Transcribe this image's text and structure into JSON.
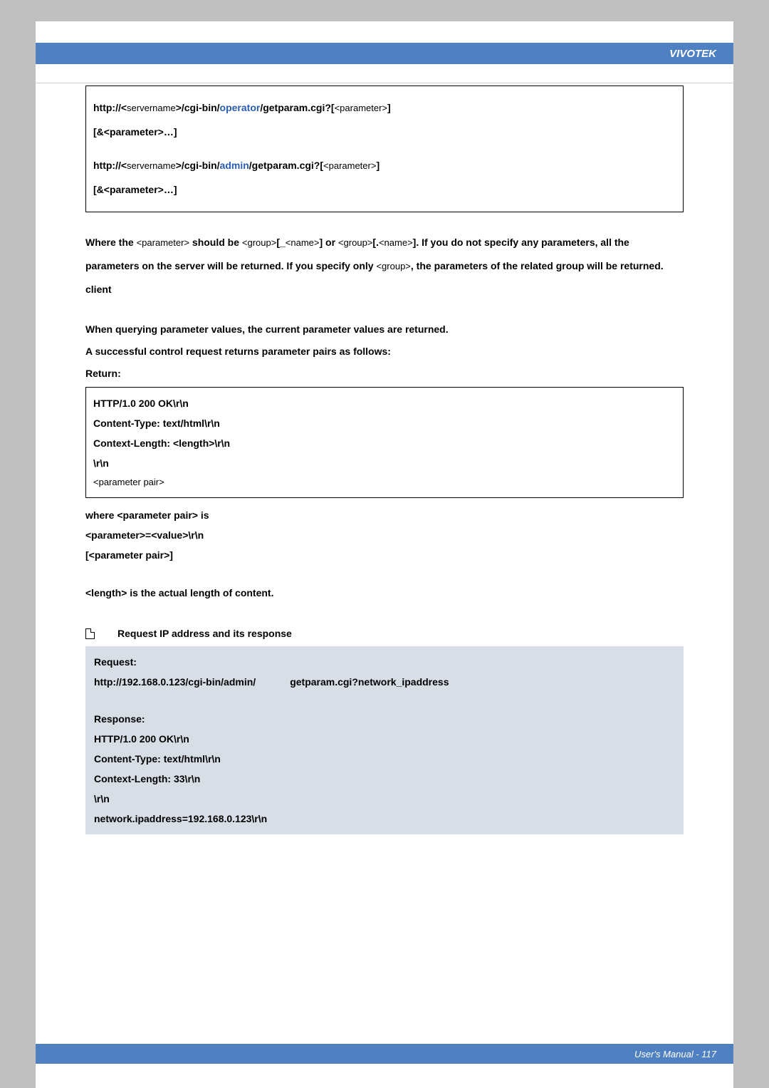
{
  "header": {
    "brand": "VIVOTEK"
  },
  "code_box": {
    "line1_a": "http://<",
    "line1_b": "servername",
    "line1_c": ">/cgi-bin/",
    "line1_d": "operator",
    "line1_e": "/getparam.cgi?[",
    "line1_f": "<parameter>",
    "line1_g": "]",
    "line2": "[&<parameter>…]",
    "line3_a": "http://<",
    "line3_b": "servername",
    "line3_c": ">/cgi-bin/",
    "line3_d": "admin",
    "line3_e": "/getparam.cgi?[",
    "line3_f": "<parameter>",
    "line3_g": "]",
    "line4": "[&<parameter>…]"
  },
  "para1": {
    "t1": "Where the ",
    "p1": "<parameter>",
    "t2": " should be ",
    "p2": "<group>",
    "t3": "[_",
    "p3": "<name>",
    "t4": "] or ",
    "p4": "<group>",
    "t5": "[.",
    "p5": "<name>",
    "t6": "]. If you do not specify any parameters, all the parameters on the server will be returned. If you specify only ",
    "p6": "<group>",
    "t7": ", the parameters of the related group will be returned. client"
  },
  "query_note": "When querying parameter values, the current parameter values are returned.",
  "success_note": "A successful control request returns parameter pairs as follows:",
  "return_label": "Return:",
  "return_box": {
    "l1": "HTTP/1.0 200 OK\\r\\n",
    "l2": "Content-Type: text/html\\r\\n",
    "l3_a": "Context-Length: <",
    "l3_b": "length>\\r\\n",
    "l4": "\\r\\n",
    "l5": "<parameter pair>"
  },
  "after_return": {
    "w1": "where <parameter pair> is",
    "w2": "<parameter>=<value>\\r\\n",
    "w3": "[<parameter pair>]"
  },
  "length_note": "<length> is the actual length of content.",
  "example": {
    "title": "Request IP address and its response",
    "request_label": "Request:",
    "req_url_a": "http://192.168.0.123/cgi-bin/admin/",
    "req_url_b": "getparam.cgi?network_ipaddress",
    "response_label": "Response:",
    "r1": "HTTP/1.0 200 OK\\r\\n",
    "r2": "Content-Type: text/html\\r\\n",
    "r3": "Context-Length: 33\\r\\n",
    "r4": "\\r\\n",
    "r5": "network.ipaddress=192.168.0.123\\r\\n"
  },
  "footer": {
    "text": "User's Manual - 117"
  }
}
